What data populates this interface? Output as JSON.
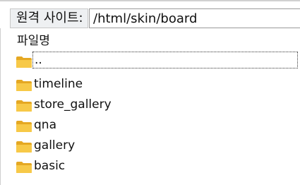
{
  "site_bar": {
    "label": "원격 사이트:",
    "path": "/html/skin/board"
  },
  "file_list": {
    "column_header": "파일명",
    "items": [
      {
        "name": "..",
        "icon": "folder-icon",
        "focused": true
      },
      {
        "name": "timeline",
        "icon": "folder-icon"
      },
      {
        "name": "store_gallery",
        "icon": "folder-icon"
      },
      {
        "name": "qna",
        "icon": "folder-icon"
      },
      {
        "name": "gallery",
        "icon": "folder-icon"
      },
      {
        "name": "basic",
        "icon": "folder-icon"
      }
    ]
  },
  "colors": {
    "folder_fill": "#f7c948",
    "folder_tab": "#e5a823"
  }
}
